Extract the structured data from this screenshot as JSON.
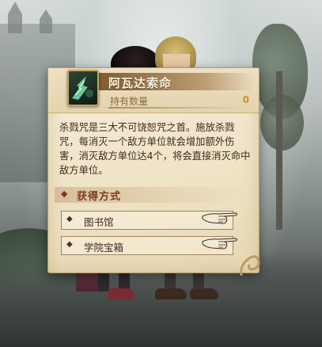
{
  "item": {
    "name": "阿瓦达索命",
    "hold_label": "持有数量",
    "hold_count": "0",
    "icon": "avada-kedavra-card-icon",
    "description": "杀戮咒是三大不可饶恕咒之首。施放杀戮咒，每消灭一个敌方单位就会增加额外伤害，消灭敌方单位达4个，将会直接消灭命中敌方单位。"
  },
  "acquire": {
    "title": "获得方式",
    "sources": [
      {
        "label": "图书馆",
        "icon": "pointing-hand-icon"
      },
      {
        "label": "学院宝箱",
        "icon": "pointing-hand-icon"
      }
    ]
  },
  "colors": {
    "card_bg": "#f1e6cc",
    "title_bar": "#7a5228",
    "accent_orange": "#c9912e",
    "source_title": "#7a3b26"
  }
}
